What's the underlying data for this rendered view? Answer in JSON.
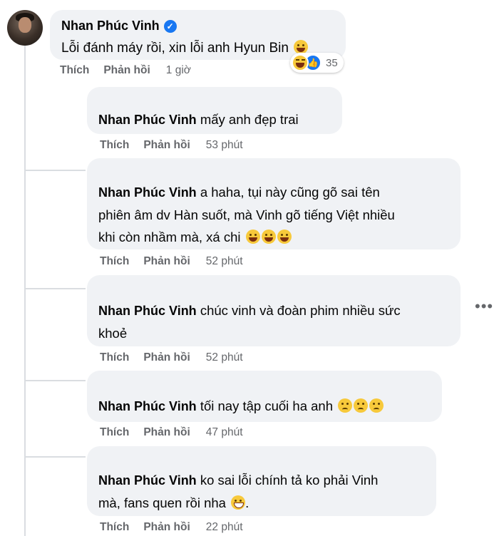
{
  "main_comment": {
    "author": "Nhan Phúc Vinh",
    "text": "Lỗi đánh máy rồi, xin lỗi anh Hyun Bin",
    "emoji": "laughing-tears-icon",
    "reactions": {
      "icons": [
        "haha-reaction-icon",
        "like-reaction-icon"
      ],
      "count": "35"
    },
    "actions": {
      "like": "Thích",
      "reply": "Phản hồi",
      "time": "1 giờ"
    }
  },
  "replies": [
    {
      "author": "Nhan Phúc Vinh",
      "text": "mấy anh đẹp trai",
      "emojis": [],
      "like": "Thích",
      "reply": "Phản hồi",
      "time": "53 phút"
    },
    {
      "author": "Nhan Phúc Vinh",
      "text_line1": "a haha, tụi này cũng gõ sai tên",
      "text_line2": "phiên âm dv Hàn suốt, mà Vinh gõ tiếng Việt nhiều",
      "text_line3": "khi còn nhầm mà, xá chi",
      "emojis": [
        "rofl-icon",
        "rofl-icon",
        "rofl-icon"
      ],
      "like": "Thích",
      "reply": "Phản hồi",
      "time": "52 phút"
    },
    {
      "author": "Nhan Phúc Vinh",
      "text_line1": "chúc vinh và đoàn phim nhiều sức",
      "text_line2": "khoẻ",
      "emojis": [],
      "like": "Thích",
      "reply": "Phản hồi",
      "time": "52 phút"
    },
    {
      "author": "Nhan Phúc Vinh",
      "text": "tối nay tập cuối ha anh",
      "emojis": [
        "sad-face-icon",
        "sad-face-icon",
        "sad-face-icon"
      ],
      "like": "Thích",
      "reply": "Phản hồi",
      "time": "47 phút"
    },
    {
      "author": "Nhan Phúc Vinh",
      "text_line1": "ko sai lỗi chính tả ko phải Vinh",
      "text_line2": "mà, fans quen rồi nha",
      "emojis": [
        "grinning-squint-icon"
      ],
      "like": "Thích",
      "reply": "Phản hồi",
      "time": "22 phút"
    }
  ],
  "colors": {
    "bubble": "#f0f2f5",
    "secondary_text": "#65676b",
    "verified": "#1877f2"
  }
}
